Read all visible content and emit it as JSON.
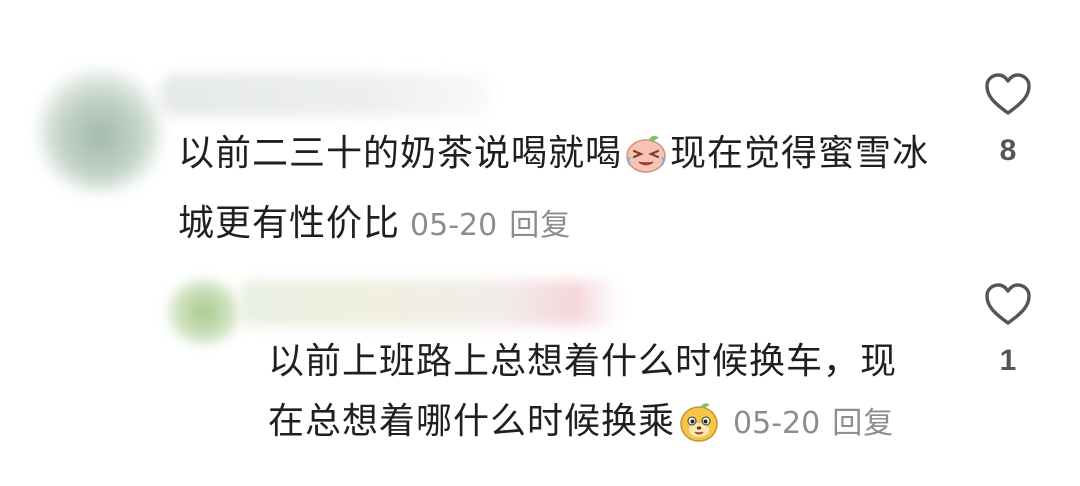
{
  "comments": [
    {
      "text_part1": "以前二三十的奶茶说喝就喝",
      "emoji": "laughing-tears-emoji",
      "text_part2": "现在觉得蜜雪冰城更有性价比",
      "date": "05-20",
      "reply_label": "回复",
      "likes": "8"
    },
    {
      "text_part1": "以前上班路上总想着什么时候换车，现在总想着哪什么时候换乘",
      "emoji": "dog-face-emoji",
      "date": "05-20",
      "reply_label": "回复",
      "likes": "1"
    }
  ],
  "icons": {
    "like": "heart-outline-icon"
  },
  "colors": {
    "text": "#1f1f1f",
    "meta": "#8d8d8d",
    "icon": "#555555"
  }
}
